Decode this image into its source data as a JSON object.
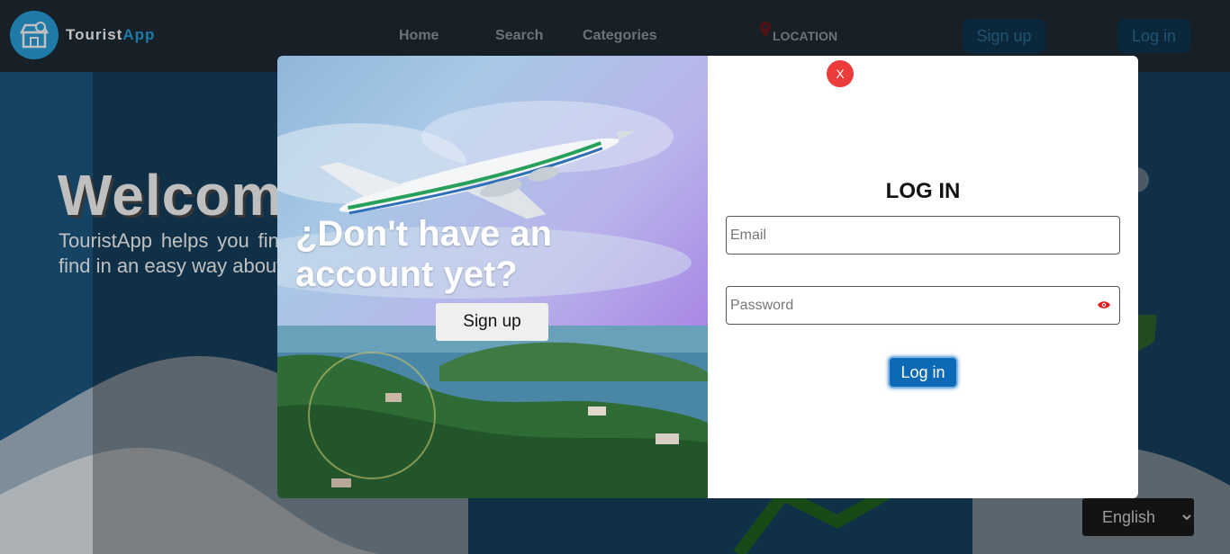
{
  "brand": {
    "name_part1": "Tourist",
    "name_part2": "App"
  },
  "nav": {
    "links": [
      "Home",
      "Search",
      "Categories"
    ],
    "location_label": "LOCATION",
    "signup_label": "Sign up",
    "login_label": "Log in"
  },
  "hero": {
    "title": "Welcome",
    "description": "TouristApp helps you find business establishments in a touristic destiny. Tourists can find in an easy way about which places to visit."
  },
  "language": {
    "selected": "English"
  },
  "modal": {
    "promo_text": "¿Don't have an account yet?",
    "promo_signup_label": "Sign up",
    "close_label": "X",
    "title": "LOG IN",
    "email_placeholder": "Email",
    "password_placeholder": "Password",
    "submit_label": "Log in"
  },
  "colors": {
    "brand_blue": "#2aa3e0",
    "nav_bg": "#1f2a35",
    "hero_blue": "#1d5a84",
    "close_red": "#ec3b3b",
    "submit_blue": "#0b69b5"
  },
  "icons": [
    "store-icon",
    "location-pin-icon",
    "eye-icon",
    "close-icon"
  ]
}
